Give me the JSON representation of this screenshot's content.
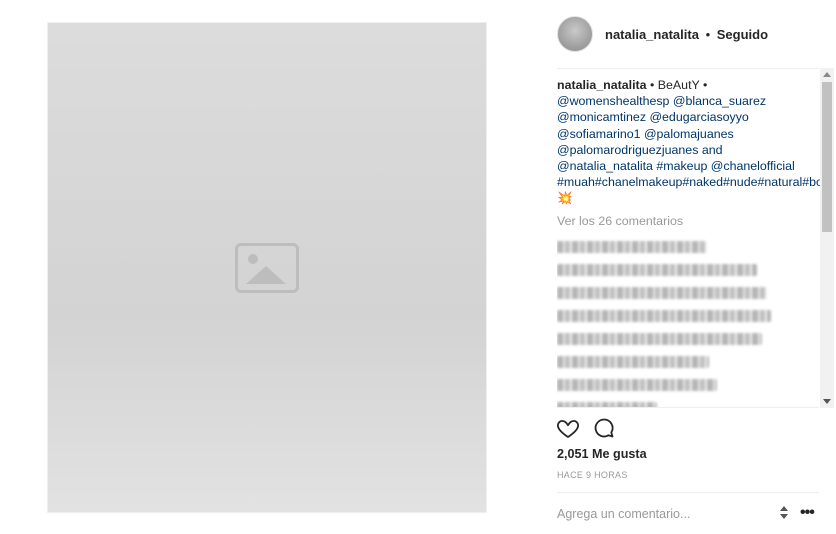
{
  "post": {
    "image_placeholder": "image placeholder"
  },
  "header": {
    "username": "natalia_natalita",
    "separator": "•",
    "follow_state": "Seguido"
  },
  "caption": {
    "author": "natalia_natalita",
    "text_before_tags": " • BeAutY • ",
    "tags_line": "@womenshealthesp @blanca_suarez @monicamtinez @edugarciasoyyo @sofiamarino1 @palomajuanes @palomarodriguezjuanes and @natalia_natalita #makeup @chanelofficial #muah#chanelmakeup#naked#nude#natural#body#fitness#woman#sexy#boom 💥"
  },
  "comments": {
    "view_all_label": "Ver los 26 comentarios",
    "blurred_count": 8
  },
  "actions": {
    "like_icon": "heart-icon",
    "comment_icon": "comment-bubble-icon"
  },
  "likes": "2,051 Me gusta",
  "timestamp": "HACE 9 HORAS",
  "comment_box": {
    "placeholder": "Agrega un comentario...",
    "options_label": "•••"
  },
  "colors": {
    "text": "#262626",
    "muted": "#999999",
    "link": "#003569",
    "divider": "#efefef"
  }
}
